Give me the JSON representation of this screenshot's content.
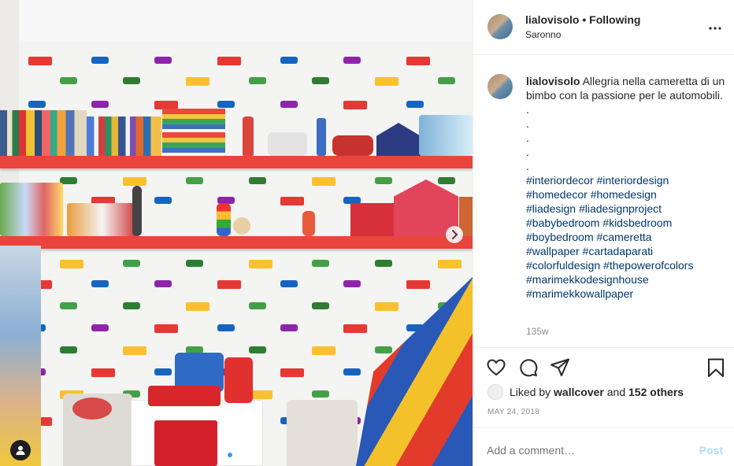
{
  "post": {
    "username": "lialovisolo",
    "separator": "•",
    "follow_status": "Following",
    "location": "Saronno",
    "more_icon": "more-horizontal-icon",
    "caption_text": "Allegria nella cameretta di un bimbo con la passione per le automobili.",
    "caption_dots": [
      ".",
      ".",
      ".",
      ".",
      "."
    ],
    "hashtag_lines": [
      "#interiordecor #interiordesign",
      "#homedecor #homedesign",
      "#liadesign #liadesignproject",
      "#babybedroom #kidsbedroom",
      "#boybedroom #cameretta",
      "#wallpaper #cartadaparati",
      "#colorfuldesign #thepowerofcolors",
      "#marimekkodesignhouse",
      "#marimekkowallpaper"
    ],
    "caption_age": "135w",
    "likes": {
      "prefix": "Liked by",
      "liker": "wallcover",
      "joiner": "and",
      "others": "152 others"
    },
    "date": "MAY 24, 2018",
    "comment_placeholder": "Add a comment…",
    "post_label": "Post"
  },
  "icons": {
    "like": "heart-icon",
    "comment": "comment-icon",
    "share": "share-icon",
    "save": "bookmark-icon",
    "next": "chevron-right-icon",
    "tag": "user-tag-icon"
  },
  "colors": {
    "link": "#00376b",
    "muted": "#8e8e8e",
    "post_disabled": "#b2dffc",
    "carousel_active": "#3897f0",
    "shelf": "#e9453d"
  },
  "carousel": {
    "current": 1,
    "total": 2
  }
}
